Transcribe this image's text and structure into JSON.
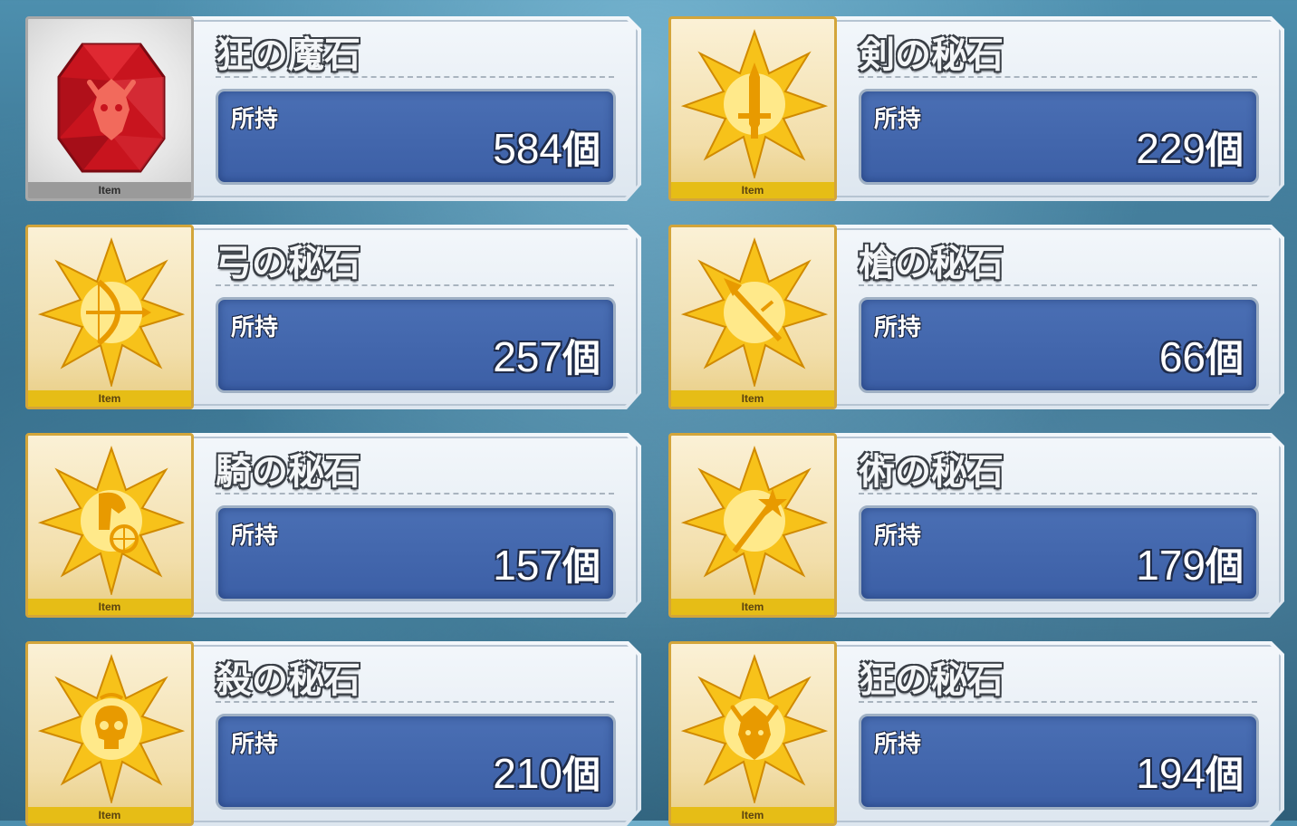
{
  "items": [
    {
      "name": "狂の魔石",
      "held_label": "所持",
      "count": "584",
      "unit": "個",
      "item_tag": "Item",
      "rarity_color": "#c8141e",
      "emblem": "berserker-emblem-icon",
      "type": "red"
    },
    {
      "name": "剣の秘石",
      "held_label": "所持",
      "count": "229",
      "unit": "個",
      "item_tag": "Item",
      "rarity_color": "#f5b400",
      "emblem": "saber-sword-icon",
      "type": "gold"
    },
    {
      "name": "弓の秘石",
      "held_label": "所持",
      "count": "257",
      "unit": "個",
      "item_tag": "Item",
      "rarity_color": "#f5b400",
      "emblem": "archer-bow-icon",
      "type": "gold"
    },
    {
      "name": "槍の秘石",
      "held_label": "所持",
      "count": "66",
      "unit": "個",
      "item_tag": "Item",
      "rarity_color": "#f5b400",
      "emblem": "lancer-spear-icon",
      "type": "gold"
    },
    {
      "name": "騎の秘石",
      "held_label": "所持",
      "count": "157",
      "unit": "個",
      "item_tag": "Item",
      "rarity_color": "#f5b400",
      "emblem": "rider-horse-icon",
      "type": "gold"
    },
    {
      "name": "術の秘石",
      "held_label": "所持",
      "count": "179",
      "unit": "個",
      "item_tag": "Item",
      "rarity_color": "#f5b400",
      "emblem": "caster-staff-icon",
      "type": "gold"
    },
    {
      "name": "殺の秘石",
      "held_label": "所持",
      "count": "210",
      "unit": "個",
      "item_tag": "Item",
      "rarity_color": "#f5b400",
      "emblem": "assassin-skull-icon",
      "type": "gold"
    },
    {
      "name": "狂の秘石",
      "held_label": "所持",
      "count": "194",
      "unit": "個",
      "item_tag": "Item",
      "rarity_color": "#f5b400",
      "emblem": "berserker-emblem-icon",
      "type": "gold"
    }
  ]
}
